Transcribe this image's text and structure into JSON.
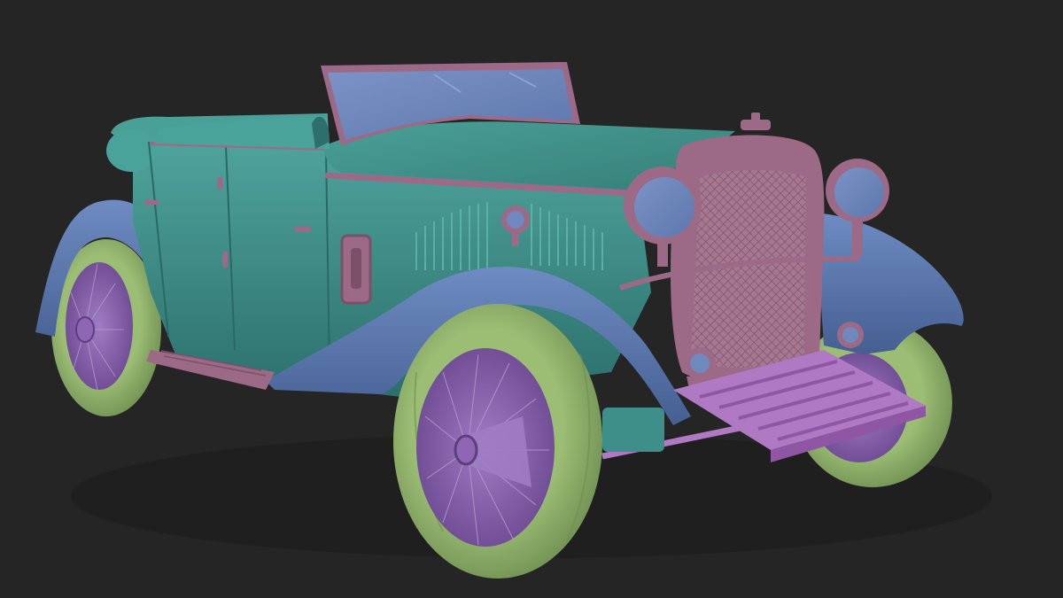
{
  "scene": {
    "background": "#252525",
    "subject": "vintage-roadster-3d-model",
    "material_colors": {
      "body": "#3e8f8a",
      "body_light": "#4fa39c",
      "body_dark": "#2c6f6c",
      "fender": "#5a78b0",
      "fender_light": "#6e8cc2",
      "fender_dark": "#455f92",
      "trim": "#9c6a86",
      "trim_dark": "#7d5069",
      "glass": "#6f88be",
      "tire": "#8fae6a",
      "tire_dark": "#6f8f52",
      "rim": "#8e66b4",
      "rim_dark": "#6d4a92",
      "spoke": "#b79ad1"
    }
  }
}
